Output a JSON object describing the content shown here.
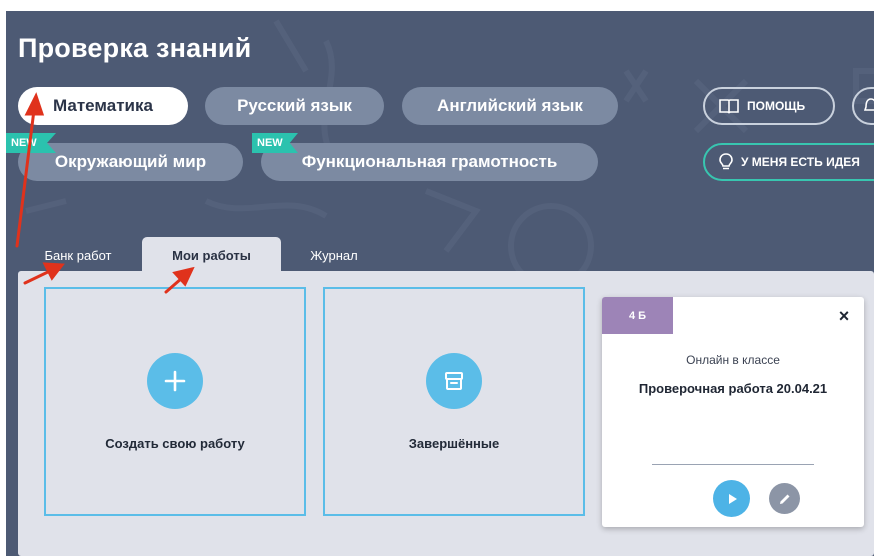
{
  "header": {
    "title": "Проверка знаний"
  },
  "subjects": [
    {
      "label": "Математика",
      "active": true
    },
    {
      "label": "Русский язык",
      "active": false
    },
    {
      "label": "Английский язык",
      "active": false
    },
    {
      "label": "Окружающий мир",
      "active": false,
      "badge": "NEW"
    },
    {
      "label": "Функциональная грамотность",
      "active": false,
      "badge": "NEW"
    }
  ],
  "actions": {
    "help_label": "помощь",
    "idea_label": "у меня есть идея"
  },
  "tabs": [
    {
      "label": "Банк работ",
      "active": false
    },
    {
      "label": "Мои работы",
      "active": true
    },
    {
      "label": "Журнал",
      "active": false
    }
  ],
  "cards": {
    "create": {
      "label": "Создать свою работу",
      "icon": "plus-icon"
    },
    "finished": {
      "label": "Завершённые",
      "icon": "archive-icon"
    }
  },
  "class_card": {
    "class": "4 Б",
    "mode": "Онлайн в классе",
    "title": "Проверочная работа 20.04.21",
    "close": "×"
  },
  "colors": {
    "background": "#4d5a74",
    "pill": "#7c8aa2",
    "panel": "#e0e2ea",
    "accent_blue": "#5bbde8",
    "new_badge": "#2bc2ae",
    "class_badge": "#9d84b7",
    "annotation_arrow": "#e0321c"
  }
}
